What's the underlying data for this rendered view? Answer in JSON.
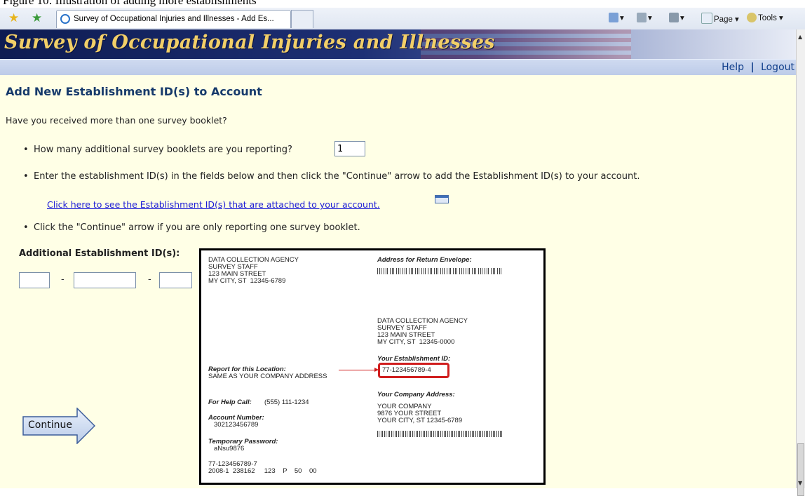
{
  "top_fragment": "Figure 10: Illustration of adding more establishments",
  "browser": {
    "tab_title": "Survey of Occupational Injuries and Illnesses - Add Es...",
    "toolbar": {
      "page_label": "Page",
      "tools_label": "Tools"
    }
  },
  "site": {
    "banner_title": "Survey of Occupational Injuries and Illnesses",
    "nav": {
      "help": "Help",
      "separator": "|",
      "logout": "Logout"
    }
  },
  "page": {
    "heading": "Add New Establishment ID(s) to Account",
    "question": "Have you received more than one survey booklet?",
    "bullet1": "How many additional survey booklets are you reporting?",
    "booklet_count": "1",
    "bullet2": "Enter the establishment ID(s) in the fields below and then click the \"Continue\" arrow to add the Establishment ID(s) to your account.",
    "link": "Click here to see the Establishment ID(s) that are attached to your account.",
    "bullet3": "Click the \"Continue\" arrow if you are only reporting one survey booklet.",
    "ids_label": "Additional Establishment ID(s):",
    "id_separator": "-",
    "continue_label": "Continue"
  },
  "sample_card": {
    "sender_address": "DATA COLLECTION AGENCY\nSURVEY STAFF\n123 MAIN STREET\nMY CITY, ST  12345-6789",
    "return_envelope_label": "Address for Return Envelope:",
    "return_address": "DATA COLLECTION AGENCY\nSURVEY STAFF\n123 MAIN STREET\nMY CITY, ST  12345-0000",
    "establishment_id_label": "Your Establishment ID:",
    "establishment_id": "77-123456789-4",
    "report_location_label": "Report for this Location:",
    "report_location": "SAME AS YOUR COMPANY ADDRESS",
    "company_address_label": "Your Company Address:",
    "company_address": "YOUR COMPANY\n9876 YOUR STREET\nYOUR CITY, ST 12345-6789",
    "help_label": "For Help Call:",
    "help_phone": "(555) 111-1234",
    "account_label": "Account Number:",
    "account_number": "302123456789",
    "password_label": "Temporary Password:",
    "password": "aNsu9876",
    "footer_line1": "77-123456789-7",
    "footer_line2": "2008-1  238162     123    P    50    00"
  }
}
